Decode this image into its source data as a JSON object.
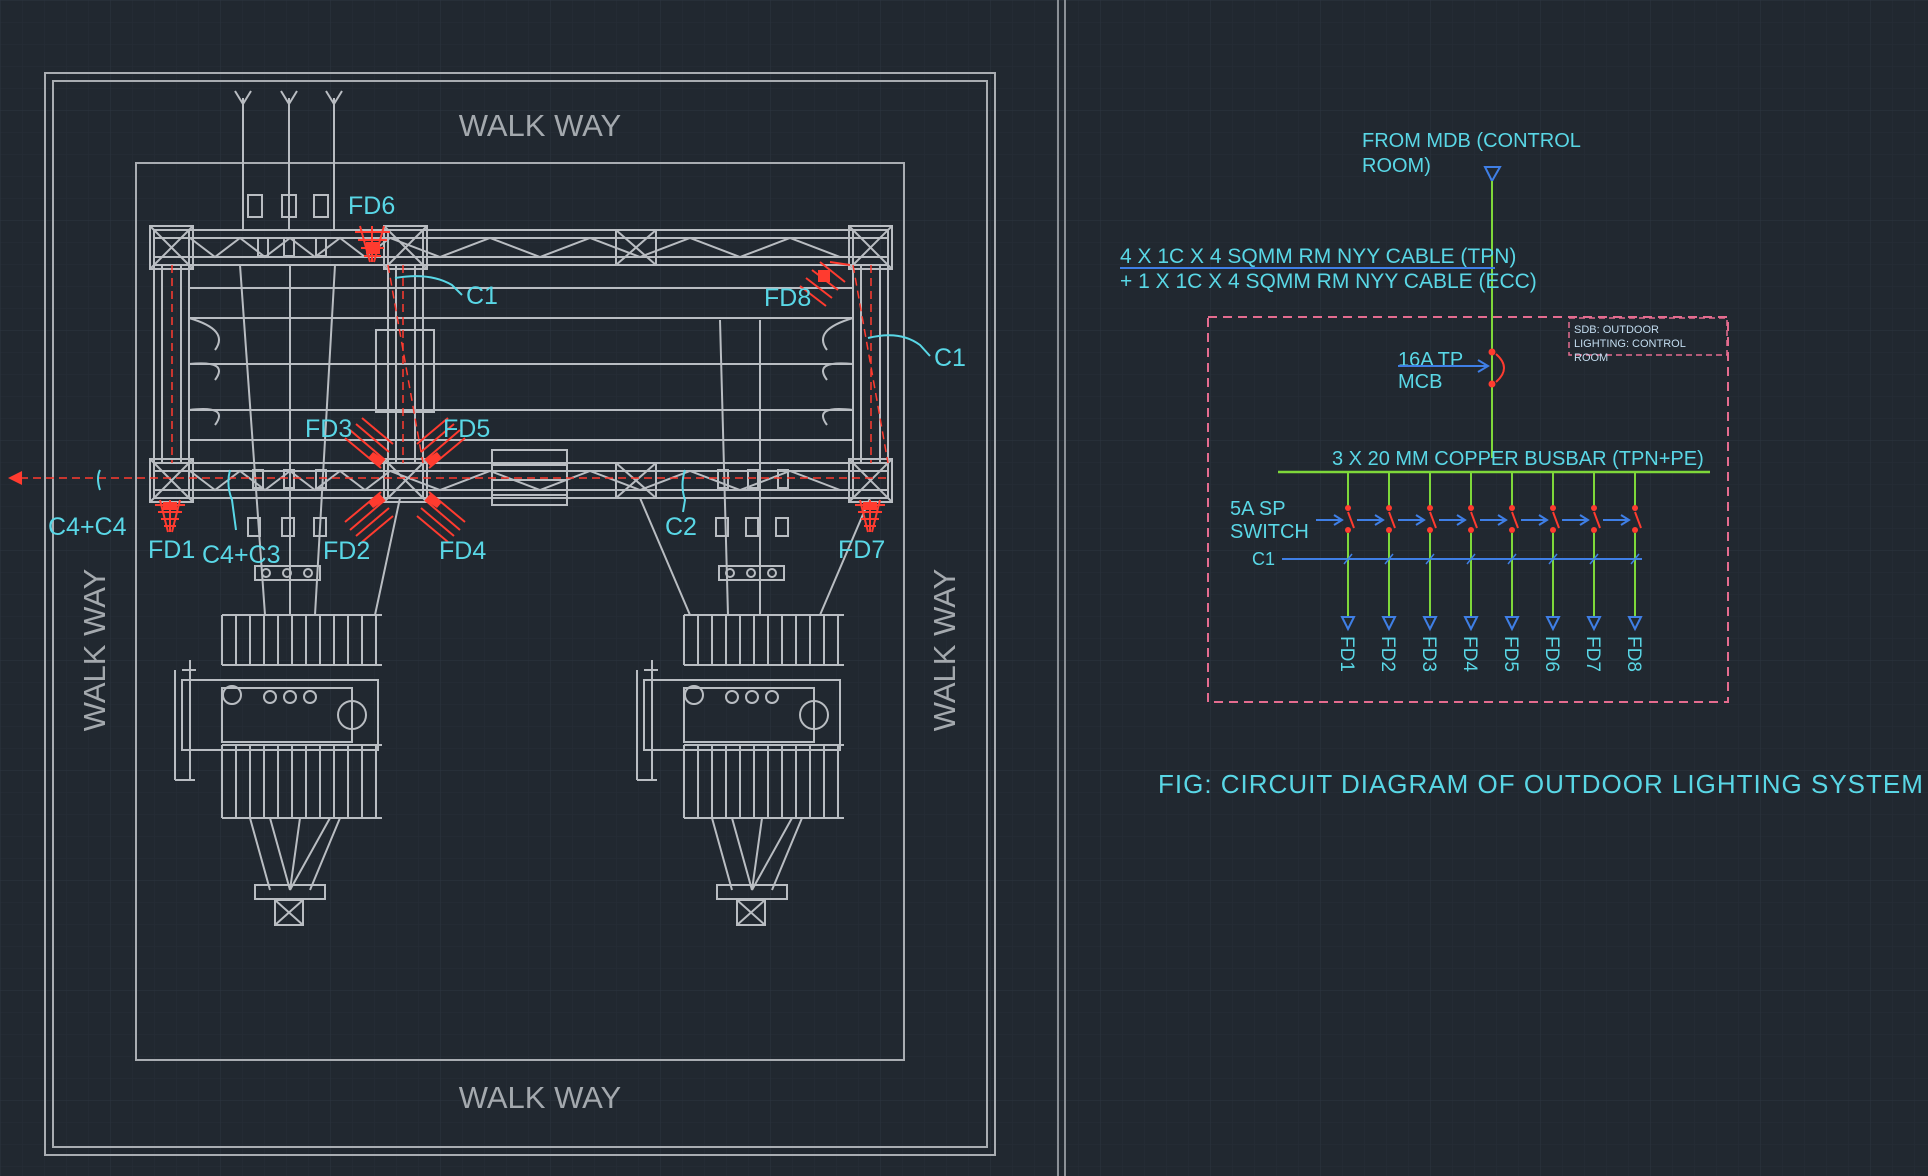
{
  "colors": {
    "background": "#212830",
    "grid_minor": "#262e37",
    "grid_major": "#2d3641",
    "plan_lines": "#b9bdc2",
    "label_text": "#59d7e6",
    "walkway_text": "#a4a9ae",
    "fixture_red": "#ff3b2f",
    "circuit_green": "#7ed83a",
    "circuit_blue": "#3f7fe6",
    "enclosure_pink": "#e56c8f",
    "sdb_label": "#c2dcef"
  },
  "plan": {
    "walkway_top": "WALK WAY",
    "walkway_bottom": "WALK WAY",
    "walkway_left": "WALK WAY",
    "walkway_right": "WALK WAY",
    "labels": {
      "fd1": "FD1",
      "fd2": "FD2",
      "fd3": "FD3",
      "fd4": "FD4",
      "fd5": "FD5",
      "fd6": "FD6",
      "fd7": "FD7",
      "fd8": "FD8",
      "c1_left": "C1",
      "c1_right": "C1",
      "c2": "C2",
      "c4c4": "C4+C4",
      "c4c3": "C4+C3"
    }
  },
  "circuit": {
    "source_line1": "FROM MDB (CONTROL",
    "source_line2": "ROOM)",
    "cable_line1": "4 X 1C X 4 SQMM RM NYY CABLE (TPN)",
    "cable_line2": "+ 1 X 1C X 4 SQMM RM NYY CABLE (ECC)",
    "sdb_line1": "SDB: OUTDOOR",
    "sdb_line2": "LIGHTING: CONTROL",
    "sdb_line3": "ROOM",
    "mcb_line1": "16A TP",
    "mcb_line2": "MCB",
    "busbar": "3 X 20 MM COPPER BUSBAR (TPN+PE)",
    "switch_line1": "5A SP",
    "switch_line2": "SWITCH",
    "c1": "C1",
    "outputs": [
      "FD1",
      "FD2",
      "FD3",
      "FD4",
      "FD5",
      "FD6",
      "FD7",
      "FD8"
    ],
    "caption": "FIG: CIRCUIT DIAGRAM OF OUTDOOR LIGHTING SYSTEM"
  }
}
